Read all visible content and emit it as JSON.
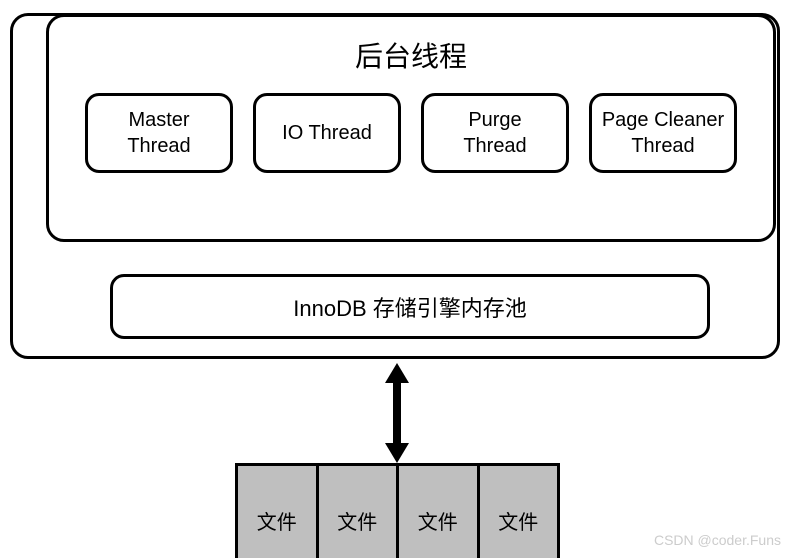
{
  "diagram": {
    "thread_section_title": "后台线程",
    "threads": [
      {
        "label": "Master\nThread"
      },
      {
        "label": "IO Thread"
      },
      {
        "label": "Purge\nThread"
      },
      {
        "label": "Page Cleaner\nThread"
      }
    ],
    "mempool_label": "InnoDB 存储引擎内存池",
    "files": [
      "文件",
      "文件",
      "文件",
      "文件"
    ]
  },
  "watermark": "CSDN @coder.Funs"
}
